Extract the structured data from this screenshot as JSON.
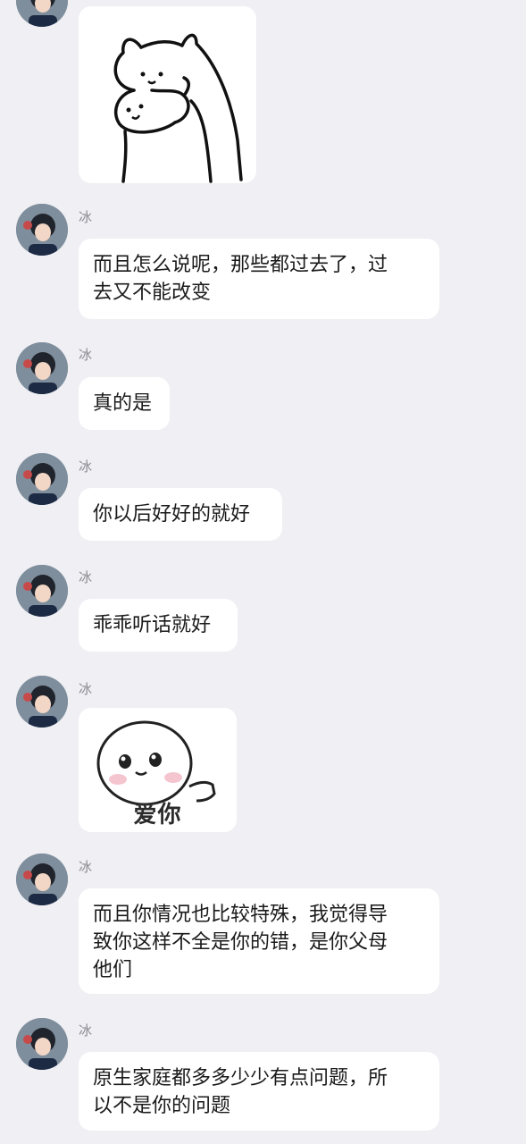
{
  "chat": {
    "sender_name": "冰",
    "messages": [
      {
        "type": "sticker",
        "icon": "bear-hug-sticker"
      },
      {
        "type": "text",
        "text": "而且怎么说呢，那些都过去了，过\n去又不能改变"
      },
      {
        "type": "text",
        "text": "真的是"
      },
      {
        "type": "text",
        "text": "你以后好好的就好"
      },
      {
        "type": "text",
        "text": "乖乖听话就好"
      },
      {
        "type": "sticker",
        "icon": "love-you-sticker",
        "caption": "爱你"
      },
      {
        "type": "text",
        "text": "而且你情况也比较特殊，我觉得导\n致你这样不全是你的错，是你父母\n他们"
      },
      {
        "type": "text",
        "text": "原生家庭都多多少少有点问题，所\n以不是你的问题"
      }
    ]
  },
  "colors": {
    "background": "#efeff4",
    "bubble": "#ffffff",
    "text": "#1a1a1a",
    "sender_name": "#8a8a8f"
  }
}
